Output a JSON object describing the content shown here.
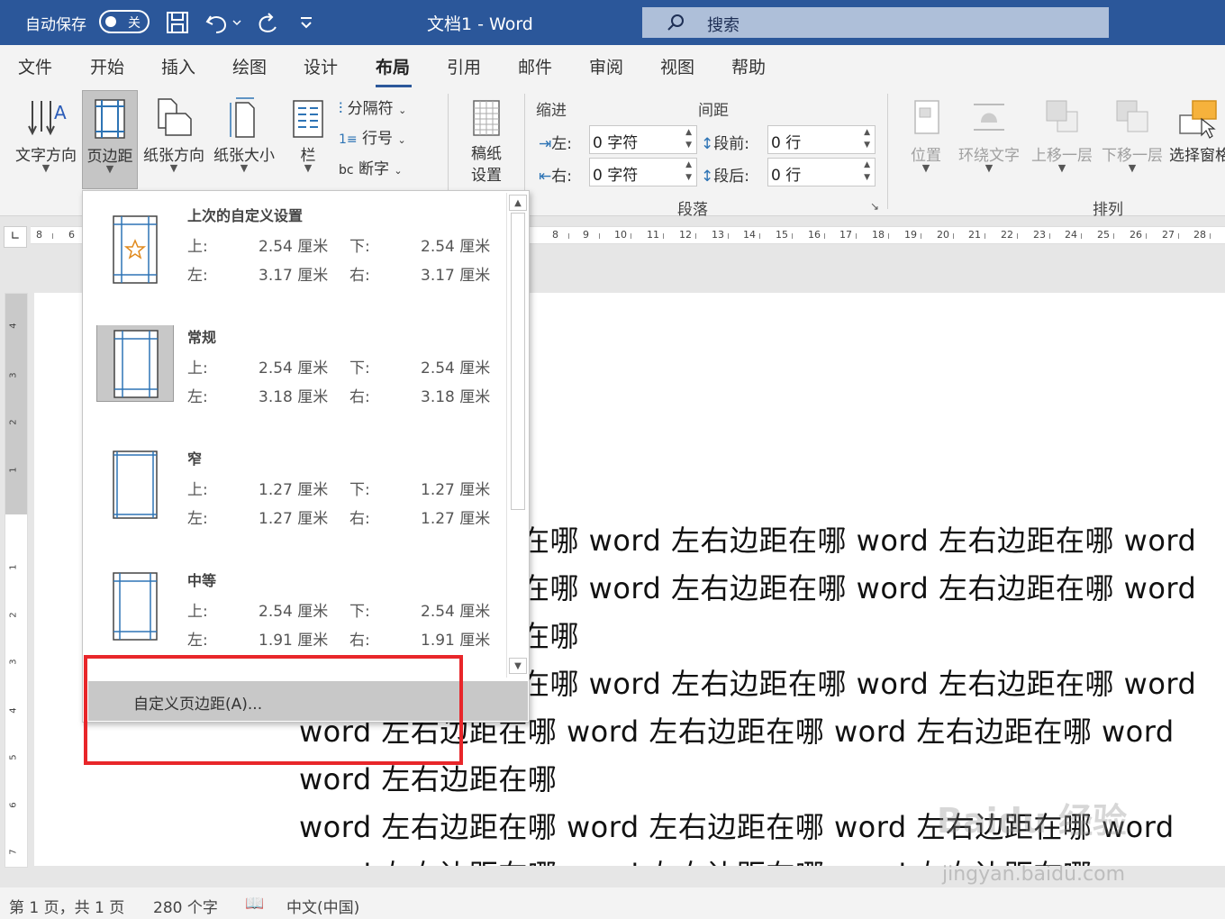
{
  "titlebar": {
    "autosave_label": "自动保存",
    "autosave_state": "关",
    "doc_title": "文档1  -  Word",
    "search_placeholder": "搜索"
  },
  "tabs": [
    "文件",
    "开始",
    "插入",
    "绘图",
    "设计",
    "布局",
    "引用",
    "邮件",
    "审阅",
    "视图",
    "帮助"
  ],
  "active_tab": "布局",
  "ribbon": {
    "text_direction": "文字方向",
    "margins": "页边距",
    "orientation": "纸张方向",
    "size": "纸张大小",
    "columns": "栏",
    "breaks": "分隔符",
    "line_numbers": "行号",
    "hyphenation": "断字",
    "manuscript_line1": "稿纸",
    "manuscript_line2": "设置",
    "indent_title": "缩进",
    "spacing_title": "间距",
    "indent_left_label": "左:",
    "indent_left_value": "0 字符",
    "indent_right_label": "右:",
    "indent_right_value": "0 字符",
    "space_before_label": "段前:",
    "space_before_value": "0 行",
    "space_after_label": "段后:",
    "space_after_value": "0 行",
    "paragraph_group": "段落",
    "position": "位置",
    "wrap_text": "环绕文字",
    "bring_forward": "上移一层",
    "send_backward": "下移一层",
    "selection_pane": "选择窗格",
    "arrange_group": "排列"
  },
  "ruler_numbers": [
    "8",
    "6",
    "8",
    "9",
    "10",
    "11",
    "12",
    "13",
    "14",
    "15",
    "16",
    "17",
    "18",
    "19",
    "20",
    "21",
    "22",
    "23",
    "24",
    "25",
    "26",
    "27",
    "28"
  ],
  "vruler_numbers": [
    "4",
    "3",
    "2",
    "1",
    "1",
    "2",
    "3",
    "4",
    "5",
    "6",
    "7"
  ],
  "margins_dropdown": {
    "presets": [
      {
        "name": "上次的自定义设置",
        "top_label": "上:",
        "top": "2.54 厘米",
        "bottom_label": "下:",
        "bottom": "2.54 厘米",
        "left_label": "左:",
        "left": "3.17 厘米",
        "right_label": "右:",
        "right": "3.17 厘米"
      },
      {
        "name": "常规",
        "top_label": "上:",
        "top": "2.54 厘米",
        "bottom_label": "下:",
        "bottom": "2.54 厘米",
        "left_label": "左:",
        "left": "3.18 厘米",
        "right_label": "右:",
        "right": "3.18 厘米"
      },
      {
        "name": "窄",
        "top_label": "上:",
        "top": "1.27 厘米",
        "bottom_label": "下:",
        "bottom": "1.27 厘米",
        "left_label": "左:",
        "left": "1.27 厘米",
        "right_label": "右:",
        "right": "1.27 厘米"
      },
      {
        "name": "中等",
        "top_label": "上:",
        "top": "2.54 厘米",
        "bottom_label": "下:",
        "bottom": "2.54 厘米",
        "left_label": "左:",
        "left": "1.91 厘米",
        "right_label": "右:",
        "right": "1.91 厘米"
      }
    ],
    "selected_preset": "常规",
    "custom_button": "自定义页边距(A)..."
  },
  "document_lines": [
    "在哪 word 左右边距在哪 word 左右边距在哪 word",
    "在哪 word 左右边距在哪 word 左右边距在哪 word",
    "在哪",
    "在哪 word 左右边距在哪 word 左右边距在哪 word",
    "word 左右边距在哪 word 左右边距在哪 word 左右边距在哪 word",
    "word 左右边距在哪",
    "word 左右边距在哪 word 左右边距在哪 word 左右边距在哪 word",
    "word 左右边距在哪 word 左右边距在哪 word 左右边距在哪"
  ],
  "statusbar": {
    "page": "第 1 页，共 1 页",
    "words": "280 个字",
    "language": "中文(中国)"
  },
  "watermark": {
    "logo": "Baidu 经验",
    "url": "jingyan.baidu.com"
  },
  "colors": {
    "titlebar": "#2b579a",
    "highlight": "#e8262a",
    "page_border_blue": "#2e74b5"
  }
}
